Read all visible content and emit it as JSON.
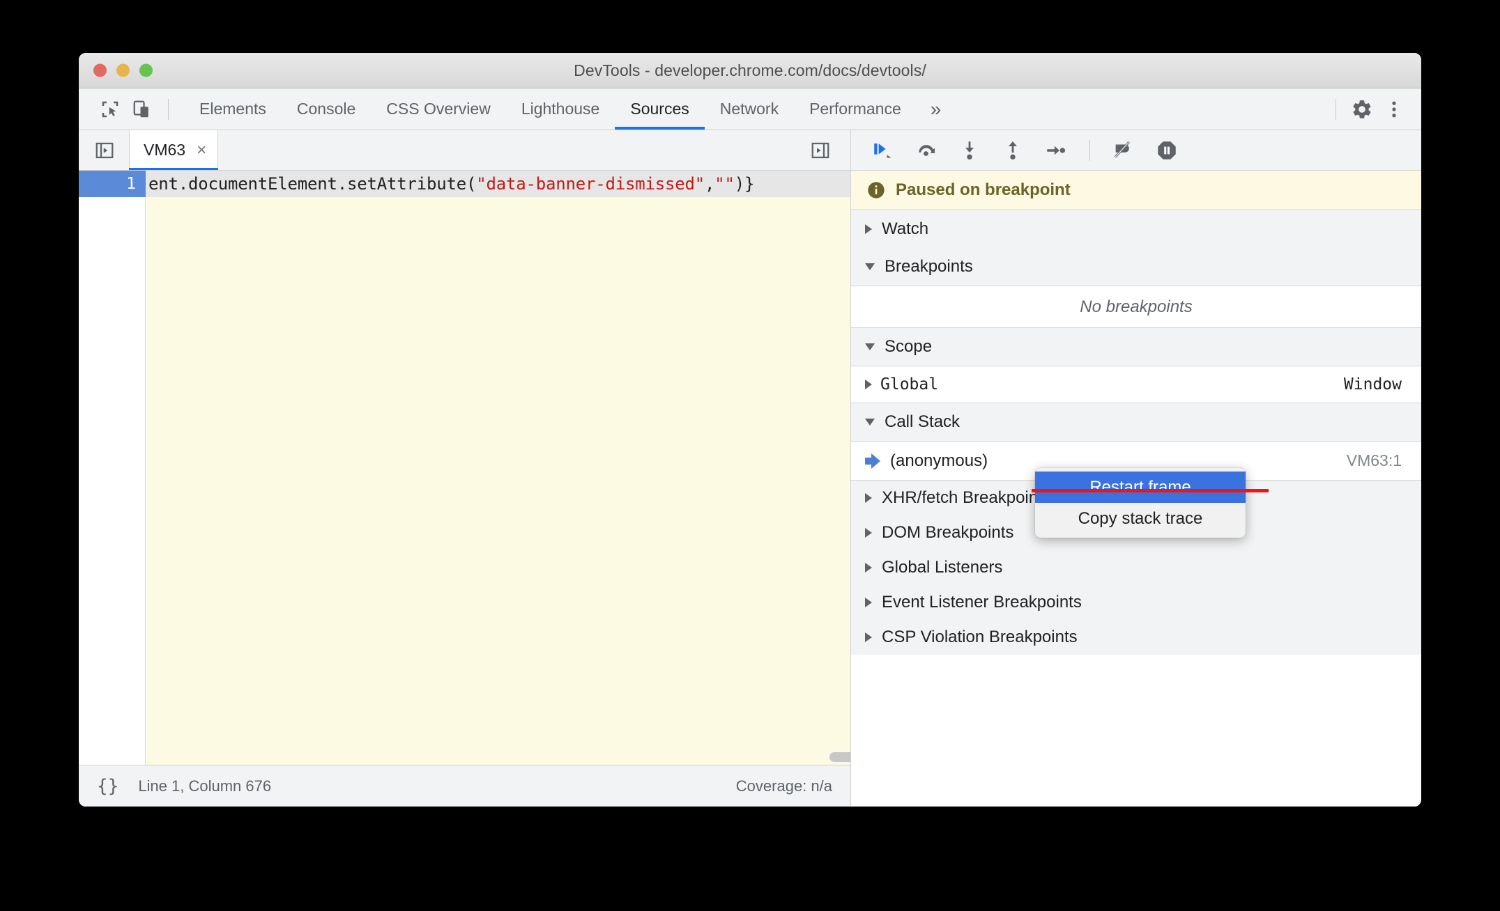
{
  "window": {
    "title": "DevTools - developer.chrome.com/docs/devtools/",
    "traffic_lights": [
      "close",
      "minimize",
      "zoom"
    ]
  },
  "panel_tabs": {
    "items": [
      {
        "label": "Elements",
        "active": false
      },
      {
        "label": "Console",
        "active": false
      },
      {
        "label": "CSS Overview",
        "active": false
      },
      {
        "label": "Lighthouse",
        "active": false
      },
      {
        "label": "Sources",
        "active": true
      },
      {
        "label": "Network",
        "active": false
      },
      {
        "label": "Performance",
        "active": false
      }
    ],
    "overflow_label": "»",
    "left_icons": [
      "inspect-element-icon",
      "device-toolbar-icon"
    ],
    "right_icons": [
      "settings-gear-icon",
      "more-options-icon"
    ]
  },
  "file_tabs": {
    "navigator_toggle": "show-navigator-icon",
    "items": [
      {
        "label": "VM63",
        "close": "×",
        "active": true
      }
    ],
    "right_toggle": "show-debugger-icon"
  },
  "editor": {
    "line_number": "1",
    "code_prefix": "ent.documentElement.setAttribute(",
    "code_string1": "\"data-banner-dismissed\"",
    "code_comma": ",",
    "code_string2": "\"\"",
    "code_suffix": ")}"
  },
  "status_bar": {
    "pretty_print_icon": "{}",
    "cursor_position": "Line 1, Column 676",
    "coverage": "Coverage: n/a"
  },
  "debugger": {
    "toolbar_buttons": [
      "resume-script-execution-icon",
      "step-over-next-function-call-icon",
      "step-into-next-function-call-icon",
      "step-out-of-current-function-icon",
      "step-icon",
      "deactivate-breakpoints-icon",
      "pause-on-exceptions-icon"
    ],
    "paused_banner": {
      "icon": "info-icon",
      "text": "Paused on breakpoint"
    },
    "sections": {
      "watch": {
        "label": "Watch",
        "expanded": false
      },
      "breakpoints": {
        "label": "Breakpoints",
        "expanded": true,
        "empty_text": "No breakpoints"
      },
      "scope": {
        "label": "Scope",
        "expanded": true
      },
      "call_stack": {
        "label": "Call Stack",
        "expanded": true
      }
    },
    "scope_rows": [
      {
        "name": "Global",
        "value": "Window",
        "expanded": false
      }
    ],
    "call_stack_frames": [
      {
        "name": "(anonymous)",
        "location": "VM63:1",
        "selected": true
      }
    ],
    "breakpoint_groups": [
      {
        "label": "XHR/fetch Breakpoints",
        "expanded": false
      },
      {
        "label": "DOM Breakpoints",
        "expanded": false
      },
      {
        "label": "Global Listeners",
        "expanded": false
      },
      {
        "label": "Event Listener Breakpoints",
        "expanded": false
      },
      {
        "label": "CSP Violation Breakpoints",
        "expanded": false
      }
    ]
  },
  "context_menu": {
    "items": [
      {
        "label": "Restart frame",
        "highlighted": true
      },
      {
        "label": "Copy stack trace",
        "highlighted": false
      }
    ]
  },
  "colors": {
    "accent_blue": "#1a73e8",
    "menu_highlight": "#3a72e0",
    "annotation_red": "#f01414",
    "paused_banner_bg": "#fdf9e2",
    "exec_line_bg": "#fdfae3",
    "string_token": "#c41a16"
  }
}
